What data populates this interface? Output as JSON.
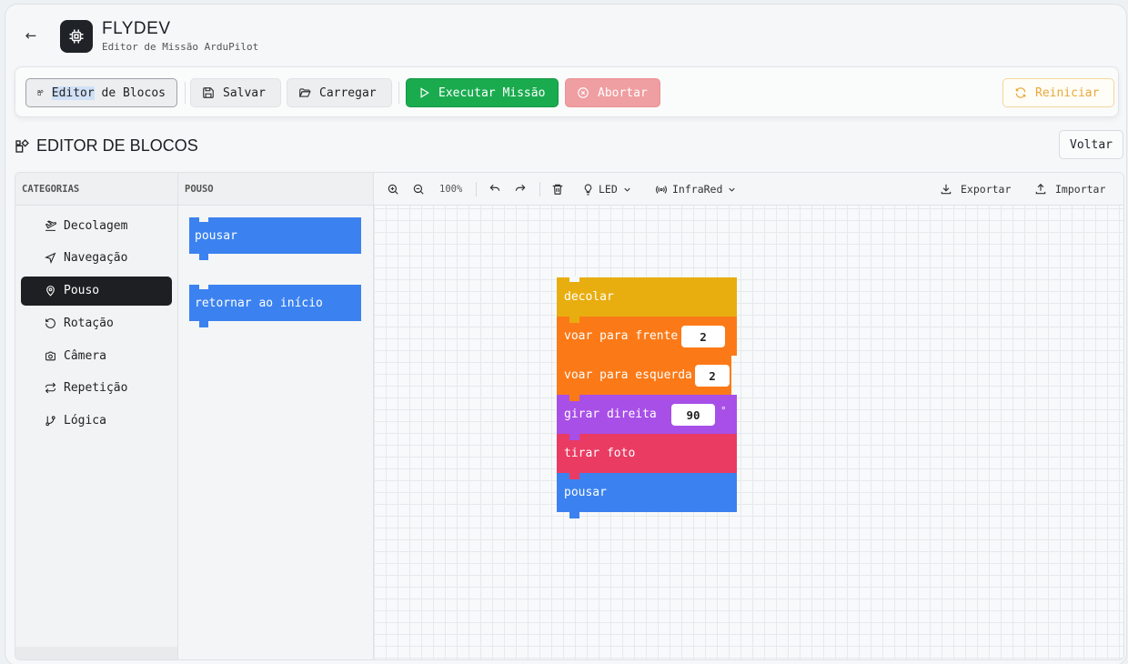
{
  "header": {
    "back_icon": "arrow-left-icon",
    "logo_icon": "chip-icon",
    "title": "FLYDEV",
    "subtitle": "Editor de Missão ArduPilot"
  },
  "toolbar": {
    "editor_label_highlight": "Editor",
    "editor_label_rest": " de Blocos",
    "save_label": "Salvar",
    "load_label": "Carregar",
    "execute_label": "Executar Missão",
    "abort_label": "Abortar",
    "restart_label": "Reiniciar"
  },
  "section": {
    "title": "EDITOR DE BLOCOS",
    "back_label": "Voltar"
  },
  "categories": {
    "header": "CATEGORIAS",
    "items": [
      {
        "label": "Decolagem",
        "icon": "plane-icon"
      },
      {
        "label": "Navegação",
        "icon": "send-icon"
      },
      {
        "label": "Pouso",
        "icon": "map-pin-icon",
        "active": true
      },
      {
        "label": "Rotação",
        "icon": "rotate-icon"
      },
      {
        "label": "Câmera",
        "icon": "camera-icon"
      },
      {
        "label": "Repetição",
        "icon": "repeat-icon"
      },
      {
        "label": "Lógica",
        "icon": "branch-icon"
      }
    ]
  },
  "palette": {
    "header": "POUSO",
    "blocks": [
      "pousar",
      "retornar ao início"
    ]
  },
  "workspace": {
    "zoom": "100%",
    "led_label": "LED",
    "infrared_label": "InfraRed",
    "export_label": "Exportar",
    "import_label": "Importar"
  },
  "program": {
    "blocks": [
      {
        "label": "decolar",
        "color": "#e8ad0f"
      },
      {
        "label": "voar para frente",
        "value": "2",
        "color": "#fb7a17"
      },
      {
        "label": "voar para esquerda",
        "value": "2",
        "color": "#fb7a17"
      },
      {
        "label": "girar direita",
        "value": "90",
        "unit": "°",
        "color": "#a84fe8"
      },
      {
        "label": "tirar foto",
        "color": "#ea3b63"
      },
      {
        "label": "pousar",
        "color": "#3b82f0"
      }
    ]
  },
  "colors": {
    "execute": "#1aab4f",
    "abort": "#ef9ea1",
    "restart": "#e8a93a",
    "palette_block": "#3b82f0"
  }
}
